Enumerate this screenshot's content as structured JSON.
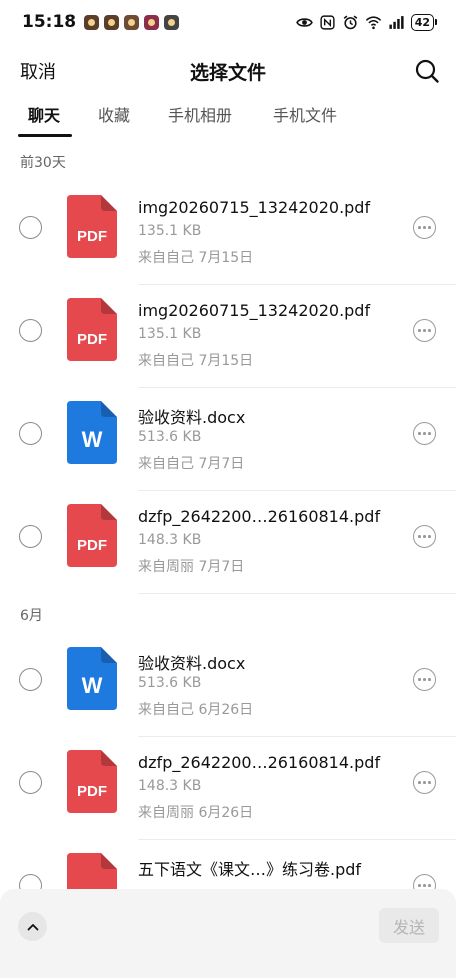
{
  "status_bar": {
    "time": "15:18",
    "battery": "42"
  },
  "header": {
    "cancel_label": "取消",
    "title": "选择文件"
  },
  "tabs": [
    {
      "label": "聊天",
      "active": true
    },
    {
      "label": "收藏",
      "active": false
    },
    {
      "label": "手机相册",
      "active": false
    },
    {
      "label": "手机文件",
      "active": false
    }
  ],
  "sections": [
    {
      "header": "前30天",
      "files": [
        {
          "name": "img20260715_13242020.pdf",
          "size": "135.1 KB",
          "source": "来自自己  7月15日",
          "type": "pdf",
          "icon_label": "PDF"
        },
        {
          "name": "img20260715_13242020.pdf",
          "size": "135.1 KB",
          "source": "来自自己  7月15日",
          "type": "pdf",
          "icon_label": "PDF"
        },
        {
          "name": "验收资料.docx",
          "size": "513.6 KB",
          "source": "来自自己  7月7日",
          "type": "word",
          "icon_label": "W"
        },
        {
          "name": "dzfp_2642200…26160814.pdf",
          "size": "148.3 KB",
          "source": "来自周丽  7月7日",
          "type": "pdf",
          "icon_label": "PDF"
        }
      ]
    },
    {
      "header": "6月",
      "files": [
        {
          "name": "验收资料.docx",
          "size": "513.6 KB",
          "source": "来自自己  6月26日",
          "type": "word",
          "icon_label": "W"
        },
        {
          "name": "dzfp_2642200…26160814.pdf",
          "size": "148.3 KB",
          "source": "来自周丽  6月26日",
          "type": "pdf",
          "icon_label": "PDF"
        },
        {
          "name": "五下语文《课文…》练习卷.pdf",
          "size": "",
          "source": "",
          "type": "pdf",
          "icon_label": "PDF"
        }
      ]
    }
  ],
  "bottom_bar": {
    "send_label": "发送"
  },
  "colors": {
    "pdf": "#e5484d",
    "word": "#1f7ae0"
  },
  "icons": [
    "eye-icon",
    "nfc-icon",
    "alarm-icon",
    "wifi-6-icon",
    "signal-icon",
    "battery-icon",
    "search-icon",
    "more-icon",
    "chevron-up-icon"
  ]
}
